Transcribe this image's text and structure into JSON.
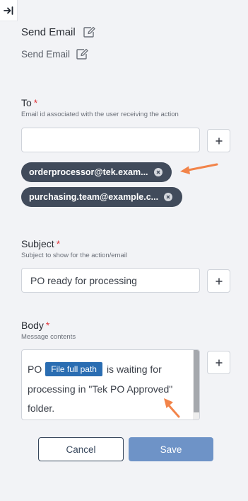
{
  "panel": {
    "collapse_icon": "collapse-right-icon"
  },
  "header": {
    "title": "Send Email",
    "subtitle": "Send Email",
    "edit_icon": "edit-icon"
  },
  "to": {
    "label": "To",
    "required_mark": "*",
    "hint": "Email id associated with the user receiving the action",
    "input_value": "",
    "add_label": "+",
    "recipients": [
      {
        "text": "orderprocessor@tek.exam..."
      },
      {
        "text": "purchasing.team@example.c..."
      }
    ]
  },
  "subject": {
    "label": "Subject",
    "required_mark": "*",
    "hint": "Subject to show for the action/email",
    "value": "PO ready for processing",
    "add_label": "+"
  },
  "body": {
    "label": "Body",
    "required_mark": "*",
    "hint": "Message contents",
    "text_before": "PO",
    "token": "File full path",
    "text_after": "is waiting for processing in \"Tek PO Approved\" folder.",
    "add_label": "+"
  },
  "actions": {
    "cancel": "Cancel",
    "save": "Save"
  },
  "colors": {
    "chip_bg": "#414b5b",
    "token_bg": "#2a6db2",
    "save_bg": "#6e93c7",
    "required": "#e0393e",
    "annotation_arrow": "#f2844a"
  }
}
